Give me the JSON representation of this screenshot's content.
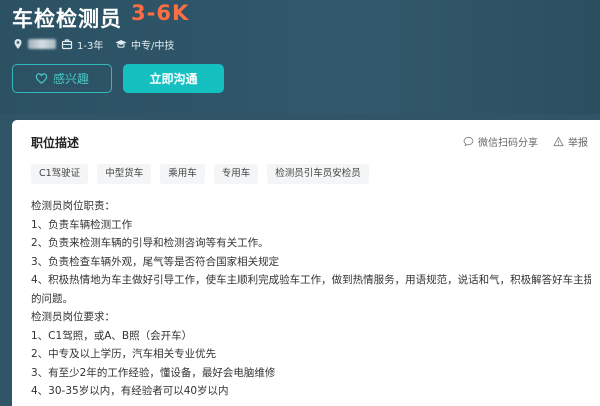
{
  "job": {
    "title": "车检检测员",
    "salary": "3-6K",
    "experience": "1-3年",
    "education": "中专/中技"
  },
  "actions": {
    "interest_label": "感兴趣",
    "chat_label": "立即沟通"
  },
  "description": {
    "title": "职位描述",
    "share_label": "微信扫码分享",
    "report_label": "举报",
    "tags": [
      "C1驾驶证",
      "中型货车",
      "乘用车",
      "专用车",
      "检测员引车员安检员"
    ],
    "lines": [
      "检测员岗位职责：",
      "1、负责车辆检测工作",
      "2、负责来检测车辆的引导和检测咨询等有关工作。",
      "3、负责检查车辆外观，尾气等是否符合国家相关规定",
      "4、积极热情地为车主做好引导工作，使车主顺利完成验车工作，做到热情服务，用语规范，说话和气，积极解答好车主提出",
      "的问题。",
      "检测员岗位要求：",
      "1、C1驾照，或A、B照（会开车）",
      "2、中专及以上学历，汽车相关专业优先",
      "3、有至少2年的工作经验，懂设备，最好会电脑维修",
      "4、30-35岁以内，有经验者可以40岁以内"
    ]
  },
  "colors": {
    "header_bg": "#2f5566",
    "salary": "#ff6e43",
    "accent": "#14c0c0"
  },
  "icons": {
    "location": "location-icon",
    "experience": "briefcase-icon",
    "education": "graduation-cap-icon",
    "interest": "heart-icon",
    "share": "chat-bubble-icon",
    "report": "warning-icon"
  }
}
